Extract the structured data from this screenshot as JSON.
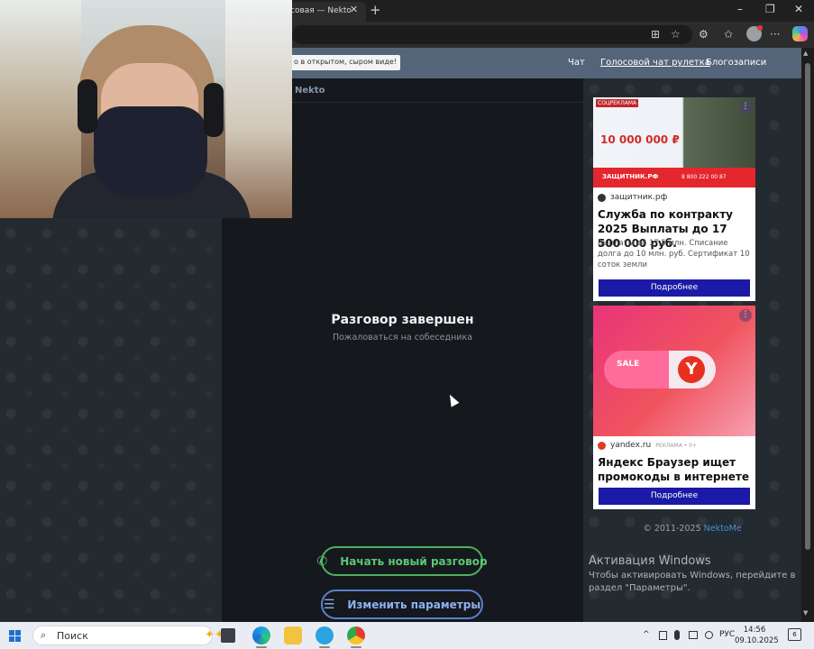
{
  "browser": {
    "tab_title": "совая — Nekto",
    "tab_close": "✕",
    "new_tab": "+",
    "window_controls": {
      "minimize": "–",
      "maximize": "❐",
      "close": "✕"
    },
    "toolbar_icons": [
      "grid-icon",
      "star-icon",
      "extensions-icon",
      "favorites-icon",
      "profile-icon",
      "more-icon",
      "copilot-icon"
    ],
    "toolbar_glyphs": {
      "apps": "⊞",
      "star": "☆",
      "extensions": "⚙",
      "favorites": "✩",
      "more": "···"
    }
  },
  "site_header": {
    "note": "о в открытом, сыром виде!",
    "nav": [
      "Чат",
      "Голосовой чат рулетка",
      "Блогозаписи"
    ]
  },
  "chat": {
    "brand": "Nekto",
    "ended_title": "Разговор завершен",
    "report_link": "Пожаловаться на собеседника",
    "new_chat_button": "Начать новый разговор",
    "new_chat_icon": "✆",
    "params_button": "Изменить параметры",
    "params_icon": "☰"
  },
  "ads": [
    {
      "image_label": "СОЦРЕКЛАМА",
      "image_amount": "10 000 000 ₽",
      "image_site": "ЗАЩИТНИК.РФ",
      "image_phone": "8 800 222 00 87",
      "source": "защитник.рф",
      "title": "Служба по контракту 2025 Выплаты до 17 500 000 руб.",
      "description": "Выплаты до 17,5 млн. Списание долга до 10 млн. руб. Сертификат 10 соток земли",
      "button": "Подробнее",
      "menu_icon": "⋮"
    },
    {
      "image_sale": "SALE",
      "image_logo": "Y",
      "source": "yandex.ru",
      "tag": "РЕКЛАМА • 0+",
      "title": "Яндекс Браузер ищет промокоды в интернете",
      "button": "Подробнее",
      "menu_icon": "⋮"
    }
  ],
  "footer": {
    "copyright_prefix": "© 2011-2025",
    "copyright_link": "NektoMe"
  },
  "windows_activation": {
    "title": "Активация Windows",
    "text": "Чтобы активировать Windows, перейдите в раздел \"Параметры\"."
  },
  "scrollbar": {
    "up": "▲",
    "down": "▼"
  },
  "taskbar": {
    "search_icon": "⌕",
    "search_placeholder": "Поиск",
    "sparkle": "✦✦",
    "apps": [
      "task-view",
      "edge",
      "file-explorer",
      "telegram",
      "chrome"
    ],
    "tray_chevron": "^",
    "tray_language": "РУС",
    "time": "14:56",
    "date": "09.10.2025",
    "notifications": "6"
  }
}
